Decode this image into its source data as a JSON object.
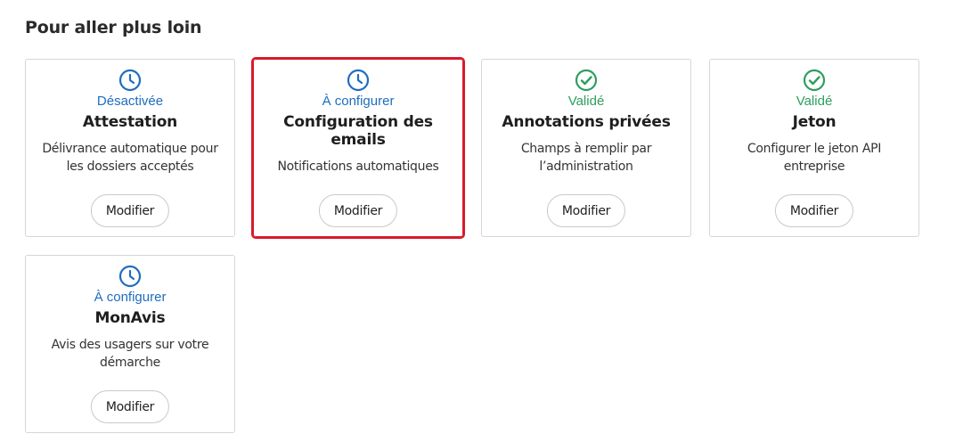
{
  "section": {
    "title": "Pour aller plus loin"
  },
  "colors": {
    "pending": "#1f6dbf",
    "valid": "#2e9e5e",
    "highlight": "#d81a2a"
  },
  "cards": [
    {
      "icon": "clock-icon",
      "status": "Désactivée",
      "title": "Attestation",
      "description": "Délivrance automatique pour les dossiers acceptés",
      "button": "Modifier"
    },
    {
      "icon": "clock-icon",
      "status": "À configurer",
      "title": "Configuration des emails",
      "description": "Notifications automatiques",
      "button": "Modifier"
    },
    {
      "icon": "check-circle-icon",
      "status": "Validé",
      "title": "Annotations privées",
      "description": "Champs à remplir par l’administration",
      "button": "Modifier"
    },
    {
      "icon": "check-circle-icon",
      "status": "Validé",
      "title": "Jeton",
      "description": "Configurer le jeton API entreprise",
      "button": "Modifier"
    },
    {
      "icon": "clock-icon",
      "status": "À configurer",
      "title": "MonAvis",
      "description": "Avis des usagers sur votre démarche",
      "button": "Modifier"
    }
  ]
}
